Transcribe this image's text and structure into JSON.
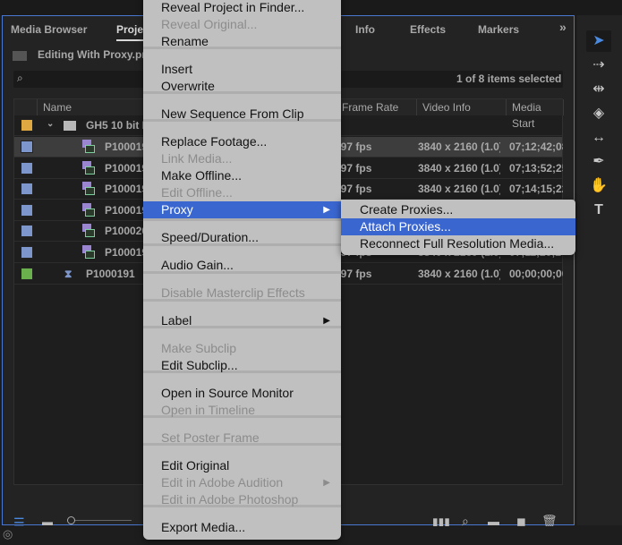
{
  "panel": {
    "tabs": [
      "Media Browser",
      "Project",
      "Info",
      "Effects",
      "Markers"
    ],
    "overflow_label": "»",
    "project_path": "Editing With Proxy.prproj",
    "selection_status": "1 of 8 items selected",
    "columns": [
      "Name",
      "Frame Rate",
      "Video Info",
      "Media Start"
    ],
    "rows": [
      {
        "name": "GH5 10 bit Footage",
        "type": "bin",
        "color": "#e0a840",
        "fps": "",
        "video": "",
        "start": ""
      },
      {
        "name": "P1000192",
        "type": "clip",
        "color": "#7d97cc",
        "fps": "29.97 fps",
        "video": "3840 x 2160 (1.0)",
        "start": "07;12;42;08",
        "selected": true
      },
      {
        "name": "P1000193",
        "type": "clip",
        "color": "#7d97cc",
        "fps": "29.97 fps",
        "video": "3840 x 2160 (1.0)",
        "start": "07;13;52;25"
      },
      {
        "name": "P1000194",
        "type": "clip",
        "color": "#7d97cc",
        "fps": "29.97 fps",
        "video": "3840 x 2160 (1.0)",
        "start": "07;14;15;22"
      },
      {
        "name": "P1000195",
        "type": "clip",
        "color": "#7d97cc",
        "fps": "",
        "video": "",
        "start": ""
      },
      {
        "name": "P1000200",
        "type": "clip",
        "color": "#7d97cc",
        "fps": "",
        "video": "",
        "start": ""
      },
      {
        "name": "P1000196",
        "type": "clip",
        "color": "#7d97cc",
        "fps": "29.97 fps",
        "video": "3840 x 2160 (1.0)",
        "start": "07;11;20;2"
      },
      {
        "name": "P1000191",
        "type": "sequence",
        "color": "#6ab04c",
        "fps": "29.97 fps",
        "video": "3840 x 2160 (1.0)",
        "start": "00;00;00;00"
      }
    ]
  },
  "context_menu": [
    {
      "label": "Reveal Project in Finder...",
      "enabled": true
    },
    {
      "label": "Reveal Original...",
      "enabled": false
    },
    {
      "label": "Rename",
      "enabled": true
    },
    {
      "label": "Insert",
      "enabled": true
    },
    {
      "label": "Overwrite",
      "enabled": true
    },
    {
      "label": "New Sequence From Clip",
      "enabled": true
    },
    {
      "label": "Replace Footage...",
      "enabled": true
    },
    {
      "label": "Link Media...",
      "enabled": false
    },
    {
      "label": "Make Offline...",
      "enabled": true
    },
    {
      "label": "Edit Offline...",
      "enabled": false
    },
    {
      "label": "Proxy",
      "enabled": true,
      "highlighted": true,
      "submenu": true
    },
    {
      "label": "Speed/Duration...",
      "enabled": true
    },
    {
      "label": "Audio Gain...",
      "enabled": true
    },
    {
      "label": "Disable Masterclip Effects",
      "enabled": false
    },
    {
      "label": "Label",
      "enabled": true,
      "submenu": true
    },
    {
      "label": "Make Subclip",
      "enabled": false
    },
    {
      "label": "Edit Subclip...",
      "enabled": true
    },
    {
      "label": "Open in Source Monitor",
      "enabled": true
    },
    {
      "label": "Open in Timeline",
      "enabled": false
    },
    {
      "label": "Set Poster Frame",
      "enabled": false
    },
    {
      "label": "Edit Original",
      "enabled": true
    },
    {
      "label": "Edit in Adobe Audition",
      "enabled": false,
      "submenu": true
    },
    {
      "label": "Edit in Adobe Photoshop",
      "enabled": false
    },
    {
      "label": "Export Media...",
      "enabled": true
    }
  ],
  "submenu": [
    {
      "label": "Create Proxies..."
    },
    {
      "label": "Attach Proxies...",
      "highlighted": true
    },
    {
      "label": "Reconnect Full Resolution Media..."
    }
  ],
  "colors": {
    "accent": "#3a66d0",
    "panel_border": "#4a78d0"
  }
}
